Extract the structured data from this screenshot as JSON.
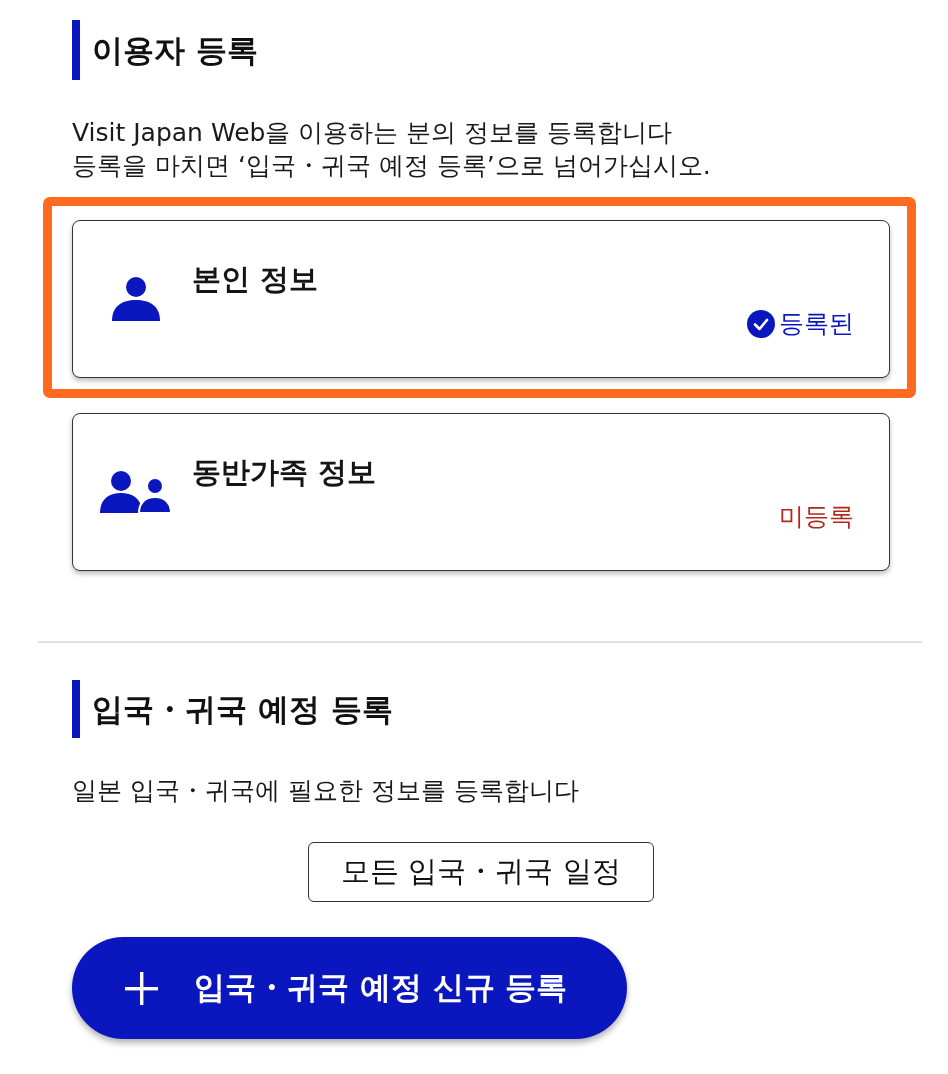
{
  "sections": [
    {
      "title": "이용자 등록",
      "description": [
        "Visit Japan Web을 이용하는 분의 정보를 등록합니다",
        "등록을 마치면 ‘입국・귀국 예정 등록’으로 넘어가십시오."
      ],
      "cards": [
        {
          "kind": "self",
          "title": "본인 정보",
          "status": "등록된",
          "registered": true,
          "highlighted": true
        },
        {
          "kind": "family",
          "title": "동반가족 정보",
          "status": "미등록",
          "registered": false,
          "highlighted": false
        }
      ]
    },
    {
      "title": "입국・귀국 예정 등록",
      "description": [
        "일본 입국・귀국에 필요한 정보를 등록합니다"
      ],
      "buttons": [
        {
          "kind": "outline",
          "label": "모든 입국・귀국 일정"
        },
        {
          "kind": "primary",
          "label": "입국・귀국 예정 신규 등록"
        }
      ]
    }
  ]
}
